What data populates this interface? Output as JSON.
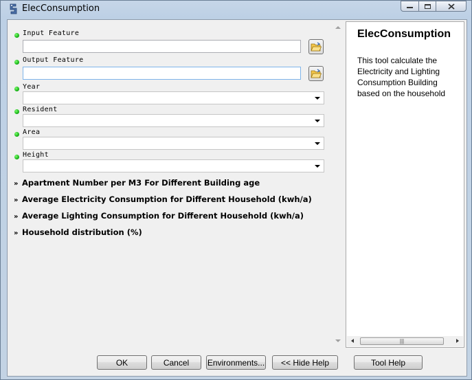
{
  "window": {
    "title": "ElecConsumption",
    "controls": [
      "minimize",
      "maximize",
      "close"
    ]
  },
  "parameters": [
    {
      "label": "Input Feature",
      "type": "text",
      "value": "",
      "browse": true,
      "required": true
    },
    {
      "label": "Output Feature",
      "type": "text",
      "value": "",
      "browse": true,
      "required": true
    },
    {
      "label": "Year",
      "type": "dropdown",
      "value": "",
      "required": true
    },
    {
      "label": "Resident",
      "type": "dropdown",
      "value": "",
      "required": true
    },
    {
      "label": "Area",
      "type": "dropdown",
      "value": "",
      "required": true
    },
    {
      "label": "Height",
      "type": "dropdown",
      "value": "",
      "required": true
    }
  ],
  "groups": [
    {
      "label": "Apartment Number per M3 For Different Building age"
    },
    {
      "label": "Average Electricity Consumption for Different Household (kwh/a)"
    },
    {
      "label": "Average Lighting Consumption for Different Household (kwh/a)"
    },
    {
      "label": "Household distribution (%)"
    }
  ],
  "help": {
    "title": "ElecConsumption",
    "body": "This tool calculate the Electricity and Lighting Consumption Building based on the household"
  },
  "buttons": {
    "ok": "OK",
    "cancel": "Cancel",
    "environments": "Environments...",
    "hide_help": "<< Hide Help",
    "tool_help": "Tool Help"
  },
  "icons": {
    "app": "python-script-icon",
    "browse": "open-folder-icon",
    "required": "green-dot-icon",
    "group": "double-chevron-down-icon"
  }
}
